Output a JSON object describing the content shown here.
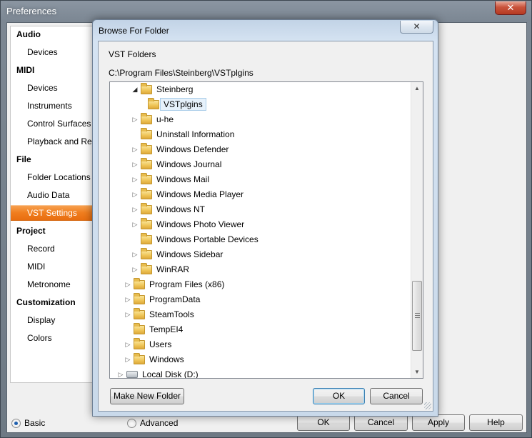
{
  "preferences": {
    "title": "Preferences",
    "close_glyph": "✕",
    "sidebar": [
      {
        "type": "section",
        "label": "Audio"
      },
      {
        "type": "item",
        "label": "Devices"
      },
      {
        "type": "section",
        "label": "MIDI"
      },
      {
        "type": "item",
        "label": "Devices"
      },
      {
        "type": "item",
        "label": "Instruments"
      },
      {
        "type": "item",
        "label": "Control Surfaces"
      },
      {
        "type": "item",
        "label": "Playback and Reco"
      },
      {
        "type": "section",
        "label": "File"
      },
      {
        "type": "item",
        "label": "Folder Locations"
      },
      {
        "type": "item",
        "label": "Audio Data"
      },
      {
        "type": "item",
        "label": "VST Settings",
        "selected": true
      },
      {
        "type": "section",
        "label": "Project"
      },
      {
        "type": "item",
        "label": "Record"
      },
      {
        "type": "item",
        "label": "MIDI"
      },
      {
        "type": "item",
        "label": "Metronome"
      },
      {
        "type": "section",
        "label": "Customization"
      },
      {
        "type": "item",
        "label": "Display"
      },
      {
        "type": "item",
        "label": "Colors"
      }
    ],
    "mode": {
      "basic_label": "Basic",
      "advanced_label": "Advanced",
      "selected": "Basic"
    },
    "buttons": {
      "ok": "OK",
      "cancel": "Cancel",
      "apply": "Apply",
      "help": "Help"
    }
  },
  "browse_dialog": {
    "title": "Browse For Folder",
    "close_glyph": "✕",
    "label": "VST Folders",
    "path": "C:\\Program Files\\Steinberg\\VSTplgins",
    "tree": [
      {
        "label": "Steinberg",
        "level": 2,
        "expander": "open"
      },
      {
        "label": "VSTplgins",
        "level": 3,
        "expander": "none",
        "selected": true
      },
      {
        "label": "u-he",
        "level": 2,
        "expander": "closed"
      },
      {
        "label": "Uninstall Information",
        "level": 2,
        "expander": "none"
      },
      {
        "label": "Windows Defender",
        "level": 2,
        "expander": "closed"
      },
      {
        "label": "Windows Journal",
        "level": 2,
        "expander": "closed"
      },
      {
        "label": "Windows Mail",
        "level": 2,
        "expander": "closed"
      },
      {
        "label": "Windows Media Player",
        "level": 2,
        "expander": "closed"
      },
      {
        "label": "Windows NT",
        "level": 2,
        "expander": "closed"
      },
      {
        "label": "Windows Photo Viewer",
        "level": 2,
        "expander": "closed"
      },
      {
        "label": "Windows Portable Devices",
        "level": 2,
        "expander": "none"
      },
      {
        "label": "Windows Sidebar",
        "level": 2,
        "expander": "closed"
      },
      {
        "label": "WinRAR",
        "level": 2,
        "expander": "closed"
      },
      {
        "label": "Program Files (x86)",
        "level": 1,
        "expander": "closed"
      },
      {
        "label": "ProgramData",
        "level": 1,
        "expander": "closed"
      },
      {
        "label": "SteamTools",
        "level": 1,
        "expander": "closed"
      },
      {
        "label": "TempEI4",
        "level": 1,
        "expander": "none"
      },
      {
        "label": "Users",
        "level": 1,
        "expander": "closed"
      },
      {
        "label": "Windows",
        "level": 1,
        "expander": "closed"
      },
      {
        "label": "Local Disk (D:)",
        "level": 0,
        "expander": "closed",
        "icon": "drive"
      }
    ],
    "buttons": {
      "make_new_folder": "Make New Folder",
      "ok": "OK",
      "cancel": "Cancel"
    }
  }
}
